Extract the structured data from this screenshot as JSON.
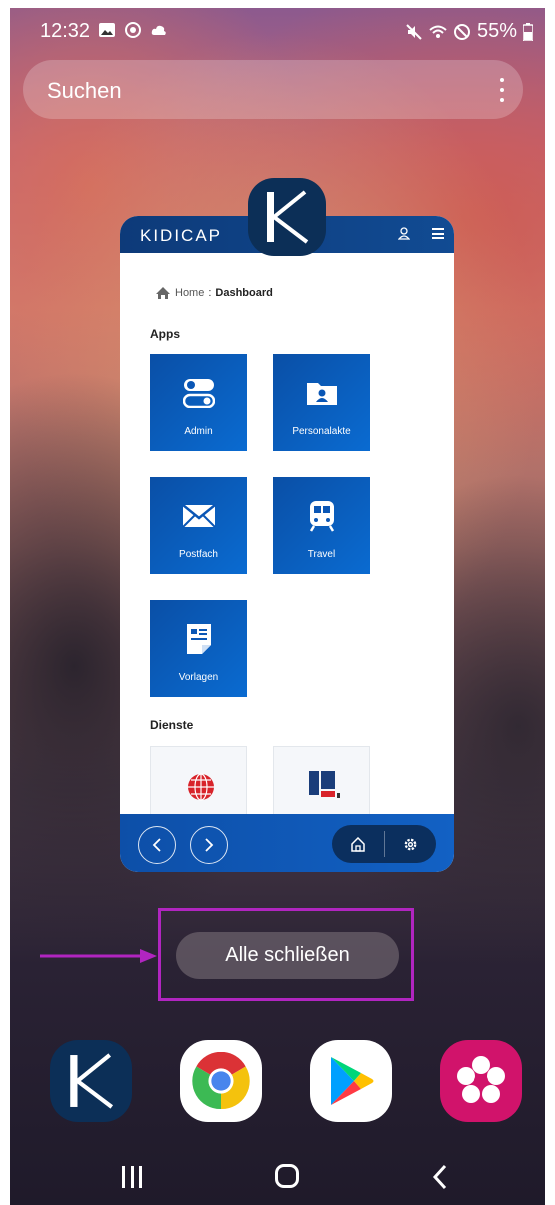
{
  "status_bar": {
    "time": "12:32",
    "battery": "55%"
  },
  "search": {
    "placeholder": "Suchen"
  },
  "app_card": {
    "logo": "KIDICAP",
    "breadcrumb": {
      "home": "Home",
      "separator": ":",
      "current": "Dashboard"
    },
    "apps_title": "Apps",
    "apps": [
      {
        "label": "Admin",
        "icon": "admin-toggle-icon"
      },
      {
        "label": "Personalakte",
        "icon": "folder-person-icon"
      },
      {
        "label": "Postfach",
        "icon": "mail-icon"
      },
      {
        "label": "Travel",
        "icon": "train-icon"
      },
      {
        "label": "Vorlagen",
        "icon": "document-icon"
      }
    ],
    "services_title": "Dienste"
  },
  "close_all": {
    "label": "Alle schließen"
  },
  "dock": [
    {
      "name": "kidicap-app",
      "icon": "kidicap-icon"
    },
    {
      "name": "chrome-app",
      "icon": "chrome-icon"
    },
    {
      "name": "play-store-app",
      "icon": "play-store-icon"
    },
    {
      "name": "flower-app",
      "icon": "flower-icon"
    }
  ],
  "colors": {
    "accent_blue": "#0a5bbd",
    "header_navy": "#0d3a79",
    "annotation_purple": "#b125c0"
  }
}
